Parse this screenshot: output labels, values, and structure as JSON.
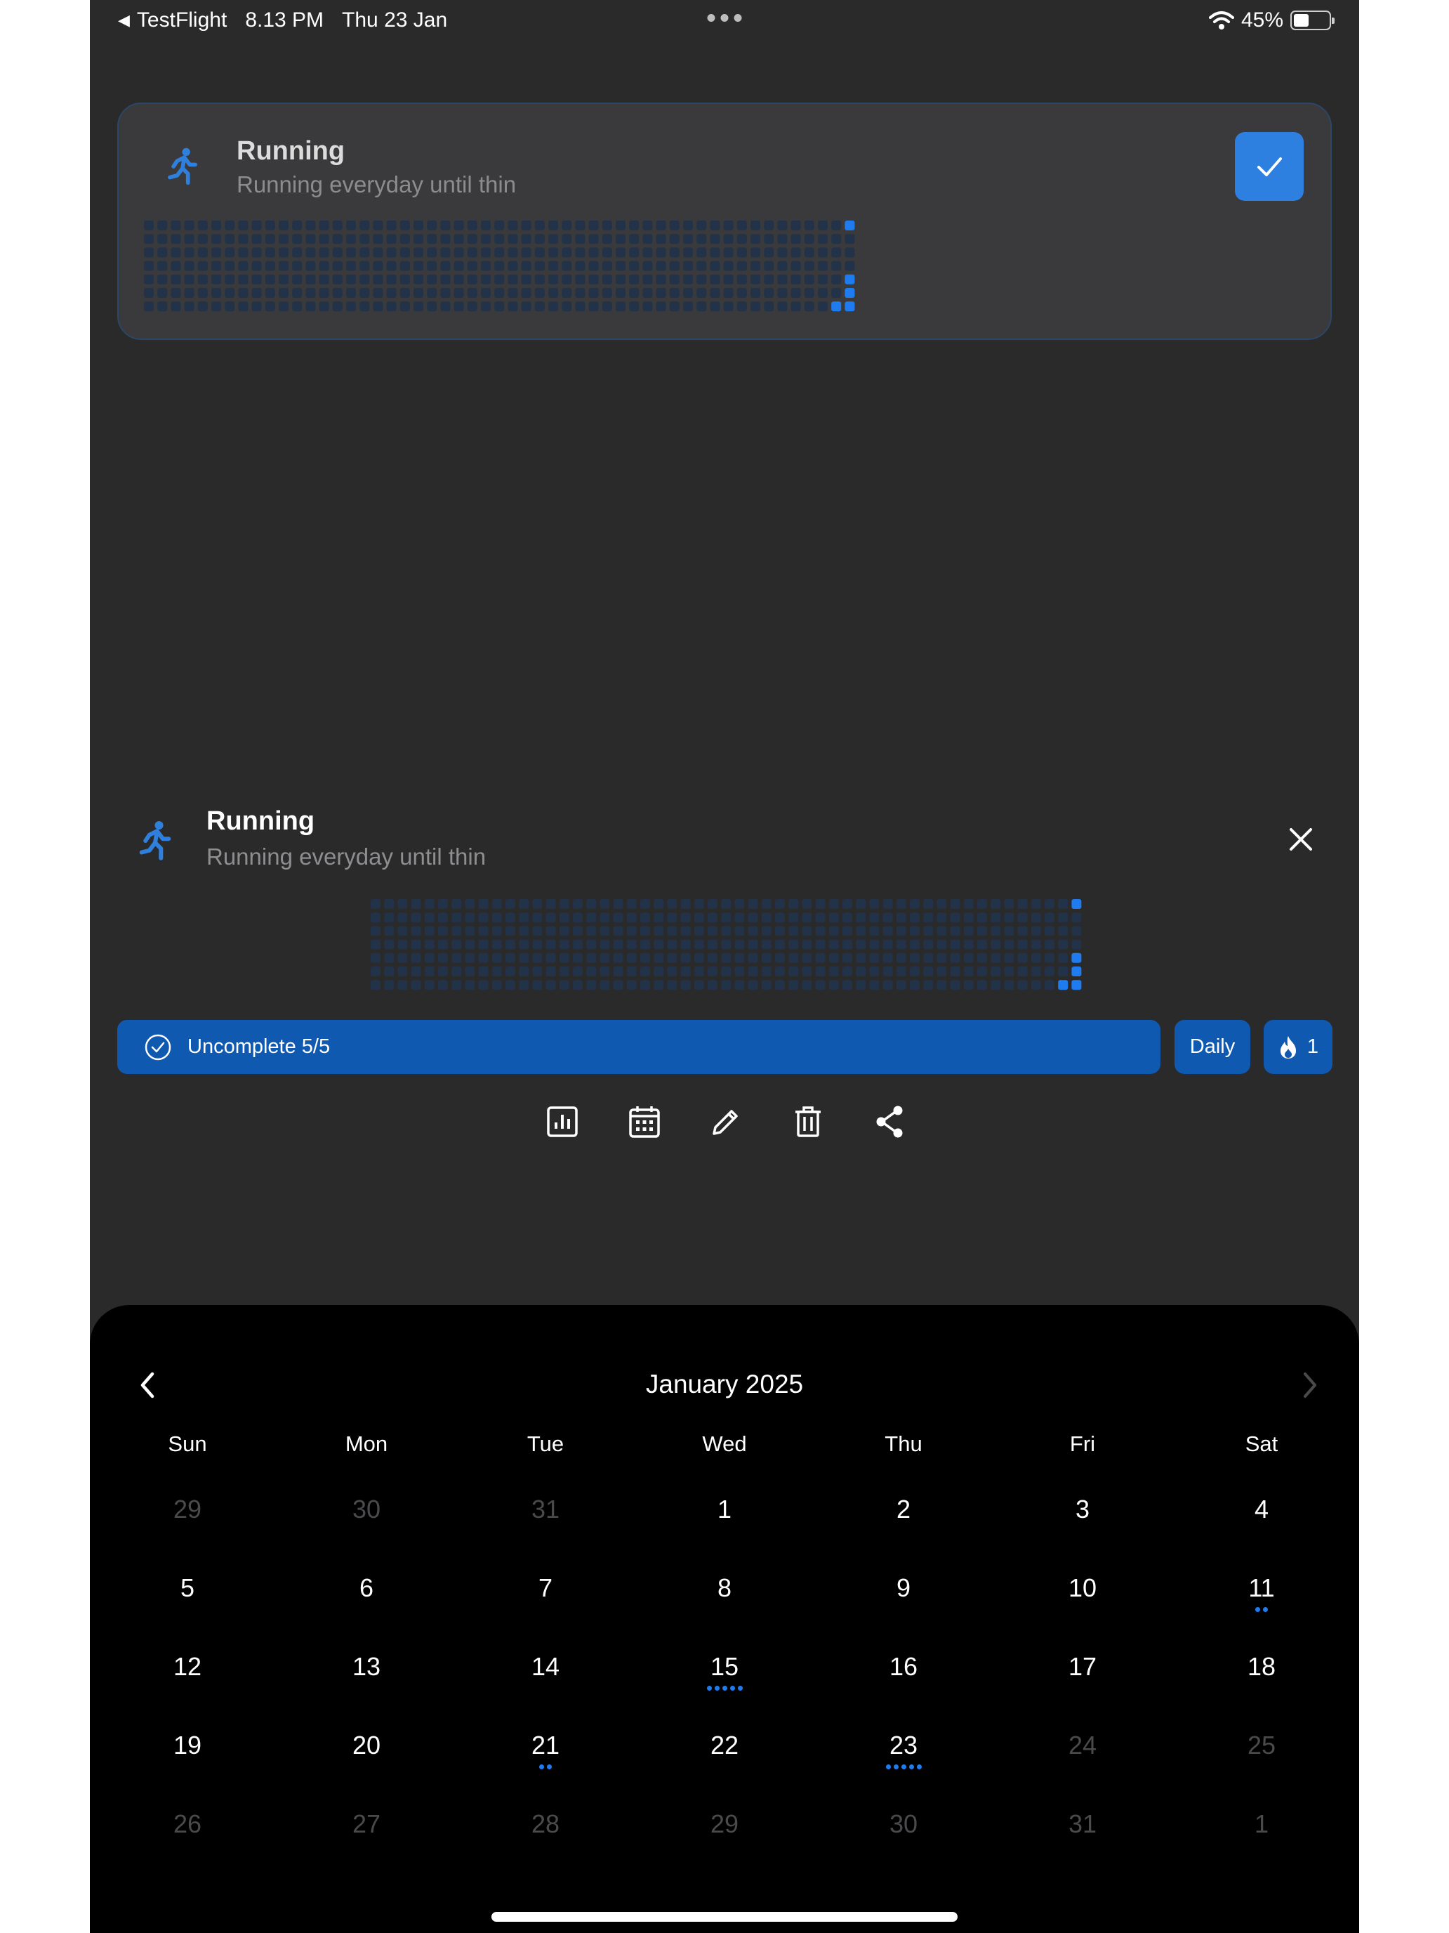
{
  "status_bar": {
    "back_app": "TestFlight",
    "time": "8.13 PM",
    "date": "Thu 23 Jan",
    "battery": "45%",
    "battery_level": 0.45
  },
  "habit_card": {
    "title": "Running",
    "subtitle": "Running everyday until thin",
    "icon": "running-person-icon",
    "checked": true
  },
  "detail": {
    "title": "Running",
    "subtitle": "Running everyday until thin",
    "icon": "running-person-icon",
    "uncomplete_label": "Uncomplete 5/5",
    "frequency_label": "Daily",
    "streak_count": "1"
  },
  "toolbar": {
    "items": [
      "stats-icon",
      "calendar-icon",
      "edit-icon",
      "delete-icon",
      "share-icon"
    ]
  },
  "calendar": {
    "month_label": "January 2025",
    "weekdays": [
      "Sun",
      "Mon",
      "Tue",
      "Wed",
      "Thu",
      "Fri",
      "Sat"
    ],
    "weeks": [
      [
        {
          "d": "29",
          "m": true
        },
        {
          "d": "30",
          "m": true
        },
        {
          "d": "31",
          "m": true
        },
        {
          "d": "1"
        },
        {
          "d": "2"
        },
        {
          "d": "3"
        },
        {
          "d": "4"
        }
      ],
      [
        {
          "d": "5"
        },
        {
          "d": "6"
        },
        {
          "d": "7"
        },
        {
          "d": "8"
        },
        {
          "d": "9"
        },
        {
          "d": "10"
        },
        {
          "d": "11",
          "dots": 2
        }
      ],
      [
        {
          "d": "12"
        },
        {
          "d": "13"
        },
        {
          "d": "14"
        },
        {
          "d": "15",
          "dots": 5
        },
        {
          "d": "16"
        },
        {
          "d": "17"
        },
        {
          "d": "18"
        }
      ],
      [
        {
          "d": "19"
        },
        {
          "d": "20"
        },
        {
          "d": "21",
          "dots": 2
        },
        {
          "d": "22"
        },
        {
          "d": "23",
          "dots": 5
        },
        {
          "d": "24",
          "m": true
        },
        {
          "d": "25",
          "m": true
        }
      ],
      [
        {
          "d": "26",
          "m": true
        },
        {
          "d": "27",
          "m": true
        },
        {
          "d": "28",
          "m": true
        },
        {
          "d": "29",
          "m": true
        },
        {
          "d": "30",
          "m": true
        },
        {
          "d": "31",
          "m": true
        },
        {
          "d": "1",
          "m": true
        }
      ]
    ]
  },
  "colors": {
    "accent": "#1f7cf0",
    "button": "#1059b1",
    "heatmap_empty": "#223248",
    "heatmap_filled": "#1f7cf0"
  },
  "heatmap": {
    "weeks": 53,
    "days_per_week": 7,
    "filled": [
      [
        52,
        0
      ],
      [
        52,
        4
      ],
      [
        52,
        5
      ],
      [
        52,
        6
      ],
      [
        51,
        6
      ]
    ]
  }
}
